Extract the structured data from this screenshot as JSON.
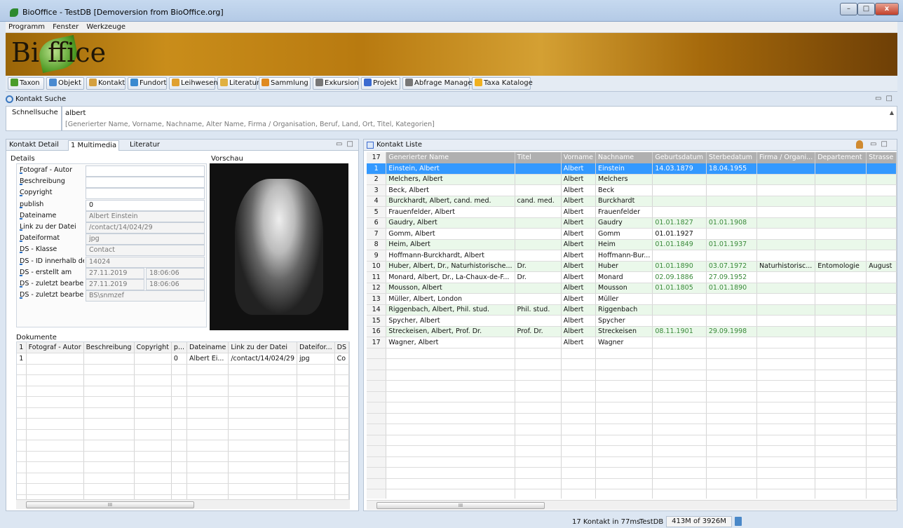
{
  "window": {
    "title": "BioOffice - TestDB [Demoversion from BioOffice.org]",
    "min": "–",
    "max": "□",
    "close": "x"
  },
  "menu": [
    "Programm",
    "Fenster",
    "Werkzeuge"
  ],
  "banner": {
    "logo": "Bi    ffice"
  },
  "toolbar": [
    {
      "label": "Taxon",
      "color": "#4a9c2a"
    },
    {
      "label": "Objekt",
      "color": "#4a8ad0"
    },
    {
      "label": "Kontakt",
      "color": "#d4a040"
    },
    {
      "label": "Fundort",
      "color": "#3a8ad0"
    },
    {
      "label": "Leihwesen",
      "color": "#e0a030"
    },
    {
      "label": "Literatur",
      "color": "#e0b040"
    },
    {
      "label": "Sammlung",
      "color": "#e08a20"
    },
    {
      "label": "Exkursion",
      "color": "#777"
    },
    {
      "label": "Projekt",
      "color": "#3a6ad0"
    },
    {
      "label": "Abfrage Manager",
      "color": "#777"
    },
    {
      "label": "Taxa Kataloge",
      "color": "#f0b020"
    }
  ],
  "search": {
    "title": "Kontakt Suche",
    "label": "Schnellsuche",
    "value": "albert",
    "hint": "[Generierter Name, Vorname, Nachname, Alter Name, Firma / Organisation, Beruf, Land, Ort, Titel, Kategorien]"
  },
  "left": {
    "tabs": [
      "Kontakt Detail",
      "1 Multimedia",
      "Literatur"
    ],
    "details_title": "Details",
    "preview_title": "Vorschau",
    "fields": [
      {
        "label": "Fotograf - Autor",
        "value": "",
        "ro": false
      },
      {
        "label": "Beschreibung",
        "value": "",
        "ro": false
      },
      {
        "label": "Copyright",
        "value": "",
        "ro": false
      },
      {
        "label": "publish",
        "value": "0",
        "ro": false
      },
      {
        "label": "Dateiname",
        "value": "Albert Einstein",
        "ro": true
      },
      {
        "label": "Link zu der Datei",
        "value": "/contact/14/024/29",
        "ro": true
      },
      {
        "label": "Dateiformat",
        "value": "jpg",
        "ro": true
      },
      {
        "label": "DS - Klasse",
        "value": "Contact",
        "ro": true
      },
      {
        "label": "DS - ID innerhalb des",
        "value": "14024",
        "ro": true
      },
      {
        "label": "DS - erstellt am",
        "value": "27.11.2019",
        "time": "18:06:06",
        "ro": true
      },
      {
        "label": "DS - zuletzt bearbeitet",
        "value": "27.11.2019",
        "time": "18:06:06",
        "ro": true
      },
      {
        "label": "DS - zuletzt bearbeitet",
        "value": "BS\\snmzef",
        "ro": true
      }
    ],
    "docs_title": "Dokumente",
    "docs_cols": [
      "1",
      "Fotograf - Autor",
      "Beschreibung",
      "Copyright",
      "p...",
      "Dateiname",
      "Link zu der Datei",
      "Dateifor...",
      "DS"
    ],
    "docs_rows": [
      [
        "1",
        "",
        "",
        "",
        "0",
        "Albert Ei...",
        "/contact/14/024/29",
        "jpg",
        "Co"
      ]
    ]
  },
  "right": {
    "title": "Kontakt Liste",
    "cols": [
      "17",
      "Generierter Name",
      "Titel",
      "Vorname",
      "Nachname",
      "Geburtsdatum",
      "Sterbedatum",
      "Firma / Organi...",
      "Departement",
      "Strasse"
    ],
    "rows": [
      [
        "1",
        "Einstein, Albert",
        "",
        "Albert",
        "Einstein",
        "14.03.1879",
        "18.04.1955",
        "",
        "",
        ""
      ],
      [
        "2",
        "Melchers, Albert",
        "",
        "Albert",
        "Melchers",
        "",
        "",
        "",
        "",
        ""
      ],
      [
        "3",
        "Beck, Albert",
        "",
        "Albert",
        "Beck",
        "",
        "",
        "",
        "",
        ""
      ],
      [
        "4",
        "Burckhardt, Albert, cand. med.",
        "cand. med.",
        "Albert",
        "Burckhardt",
        "",
        "",
        "",
        "",
        ""
      ],
      [
        "5",
        "Frauenfelder, Albert",
        "",
        "Albert",
        "Frauenfelder",
        "",
        "",
        "",
        "",
        ""
      ],
      [
        "6",
        "Gaudry, Albert",
        "",
        "Albert",
        "Gaudry",
        "01.01.1827",
        "01.01.1908",
        "",
        "",
        ""
      ],
      [
        "7",
        "Gomm, Albert",
        "",
        "Albert",
        "Gomm",
        "01.01.1927",
        "",
        "",
        "",
        ""
      ],
      [
        "8",
        "Heim, Albert",
        "",
        "Albert",
        "Heim",
        "01.01.1849",
        "01.01.1937",
        "",
        "",
        ""
      ],
      [
        "9",
        "Hoffmann-Burckhardt, Albert",
        "",
        "Albert",
        "Hoffmann-Bur...",
        "",
        "",
        "",
        "",
        ""
      ],
      [
        "10",
        "Huber, Albert, Dr., Naturhistorische...",
        "Dr.",
        "Albert",
        "Huber",
        "01.01.1890",
        "03.07.1972",
        "Naturhistorisc...",
        "Entomologie",
        "August"
      ],
      [
        "11",
        "Monard, Albert, Dr., La-Chaux-de-F...",
        "Dr.",
        "Albert",
        "Monard",
        "02.09.1886",
        "27.09.1952",
        "",
        "",
        ""
      ],
      [
        "12",
        "Mousson, Albert",
        "",
        "Albert",
        "Mousson",
        "01.01.1805",
        "01.01.1890",
        "",
        "",
        ""
      ],
      [
        "13",
        "Müller, Albert, London",
        "",
        "Albert",
        "Müller",
        "",
        "",
        "",
        "",
        ""
      ],
      [
        "14",
        "Riggenbach, Albert, Phil. stud.",
        "Phil. stud.",
        "Albert",
        "Riggenbach",
        "",
        "",
        "",
        "",
        ""
      ],
      [
        "15",
        "Spycher, Albert",
        "",
        "Albert",
        "Spycher",
        "",
        "",
        "",
        "",
        ""
      ],
      [
        "16",
        "Streckeisen, Albert, Prof. Dr.",
        "Prof. Dr.",
        "Albert",
        "Streckeisen",
        "08.11.1901",
        "29.09.1998",
        "",
        "",
        ""
      ],
      [
        "17",
        "Wagner, Albert",
        "",
        "Albert",
        "Wagner",
        "",
        "",
        "",
        "",
        ""
      ]
    ]
  },
  "status": {
    "info": "17 Kontakt in 77ms",
    "db": "TestDB",
    "mem": "413M of 3926M"
  },
  "scroll": {
    "thumb": "III"
  }
}
